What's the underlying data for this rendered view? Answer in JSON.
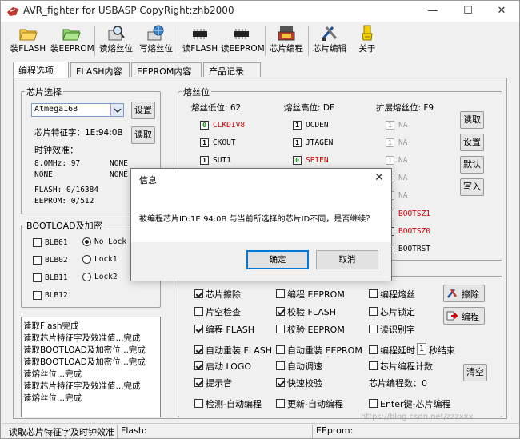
{
  "window": {
    "title": "AVR_fighter for USBASP CopyRight:zhb2000"
  },
  "toolbar": {
    "buttons": [
      {
        "label": "装FLASH",
        "icon": "folder-icon"
      },
      {
        "label": "装EEPROM",
        "icon": "folder-icon"
      },
      {
        "label": "读熔丝位",
        "icon": "magnifier-icon"
      },
      {
        "label": "写熔丝位",
        "icon": "globe-icon"
      },
      {
        "label": "读FLASH",
        "icon": "chip-icon"
      },
      {
        "label": "读EEPROM",
        "icon": "chip-icon"
      },
      {
        "label": "芯片编程",
        "icon": "programmer-icon"
      },
      {
        "label": "芯片编辑",
        "icon": "edit-tools-icon"
      },
      {
        "label": "关于",
        "icon": "about-icon"
      }
    ]
  },
  "tabs": [
    "编程选项",
    "FLASH内容",
    "EEPROM内容",
    "产品记录"
  ],
  "chip_select": {
    "group_title": "芯片选择",
    "selected": "Atmega168",
    "settings_btn": "设置",
    "read_btn": "读取",
    "signature": "芯片特征字：1E:94:0B",
    "calib_title": "时钟效准：",
    "calib_r1c1": "8.0MHz: 97",
    "calib_r1c2": "NONE",
    "calib_r2c1": "NONE",
    "calib_r2c2": "NONE",
    "flash": "FLASH: 0/16384",
    "eeprom": "EEPROM: 0/512"
  },
  "fuse": {
    "group_title": "熔丝位",
    "low_label": "熔丝低位: 62",
    "high_label": "熔丝高位: DF",
    "ext_label": "扩展熔丝位: F9",
    "low_bits": [
      {
        "val": "0",
        "name": "CLKDIV8"
      },
      {
        "val": "1",
        "name": "CKOUT"
      },
      {
        "val": "1",
        "name": "SUT1"
      }
    ],
    "high_bits": [
      {
        "val": "1",
        "name": "OCDEN"
      },
      {
        "val": "1",
        "name": "JTAGEN"
      },
      {
        "val": "0",
        "name": "SPIEN"
      }
    ],
    "ext_bits": [
      {
        "val": "1",
        "name": "NA"
      },
      {
        "val": "1",
        "name": "NA"
      },
      {
        "val": "1",
        "name": "NA"
      },
      {
        "val": "1",
        "name": "NA"
      },
      {
        "val": "1",
        "name": "NA"
      },
      {
        "val": "",
        "name": "BOOTSZ1"
      },
      {
        "val": "",
        "name": "BOOTSZ0"
      },
      {
        "val": "",
        "name": "BOOTRST"
      }
    ],
    "buttons": [
      "读取",
      "设置",
      "默认",
      "写入"
    ]
  },
  "bootload": {
    "group_title": "BOOTLOAD及加密",
    "items": [
      "BLB01",
      "BLB02",
      "BLB11",
      "BLB12"
    ],
    "radios": [
      "No Lock",
      "Lock1",
      "Lock2"
    ]
  },
  "log": {
    "lines": [
      "读取Flash完成",
      "读取芯片特征字及效准值...完成",
      "读取BOOTLOAD及加密位...完成",
      "读取BOOTLOAD及加密位...完成",
      "读熔丝位...完成",
      "读取芯片特征字及效准值...完成",
      "读熔丝位...完成"
    ]
  },
  "options": {
    "rows": [
      [
        {
          "label": "芯片擦除",
          "on": true
        },
        {
          "label": "编程 EEPROM",
          "on": false
        },
        {
          "label": "编程熔丝",
          "on": false
        }
      ],
      [
        {
          "label": "片空检查",
          "on": false
        },
        {
          "label": "校验 FLASH",
          "on": true
        },
        {
          "label": "芯片锁定",
          "on": false
        }
      ],
      [
        {
          "label": "编程 FLASH",
          "on": true
        },
        {
          "label": "校验 EEPROM",
          "on": false
        },
        {
          "label": "读识别字",
          "on": false
        }
      ],
      [
        {
          "label": "自动重装 FLASH",
          "on": true
        },
        {
          "label": "自动重装 EEPROM",
          "on": false
        },
        {
          "label": "编程延时",
          "on": false
        }
      ],
      [
        {
          "label": "启动 LOGO",
          "on": true
        },
        {
          "label": "自动调速",
          "on": false
        },
        {
          "label": "芯片编程计数",
          "on": false
        }
      ],
      [
        {
          "label": "提示音",
          "on": true
        },
        {
          "label": "快速校验",
          "on": true
        }
      ],
      [
        {
          "label": "检测-自动编程",
          "on": false
        },
        {
          "label": "更新-自动编程",
          "on": false
        },
        {
          "label": "Enter键-芯片编程",
          "on": false
        }
      ]
    ],
    "delay_value": "1",
    "delay_suffix": "秒结束",
    "count_label": "芯片编程数：0",
    "erase_btn": "擦除",
    "program_btn": "编程",
    "clear_btn": "清空"
  },
  "statusbar": {
    "status": "读取芯片特征字及时钟效准",
    "flash": "Flash:",
    "eeprom": "EEprom:",
    "watermark": "https://blog.csdn.net/zzzxxx"
  },
  "dialog": {
    "title": "信息",
    "message": "被编程芯片ID:1E:94:0B 与当前所选择的芯片ID不同，是否继续？",
    "ok": "确定",
    "cancel": "取消"
  }
}
